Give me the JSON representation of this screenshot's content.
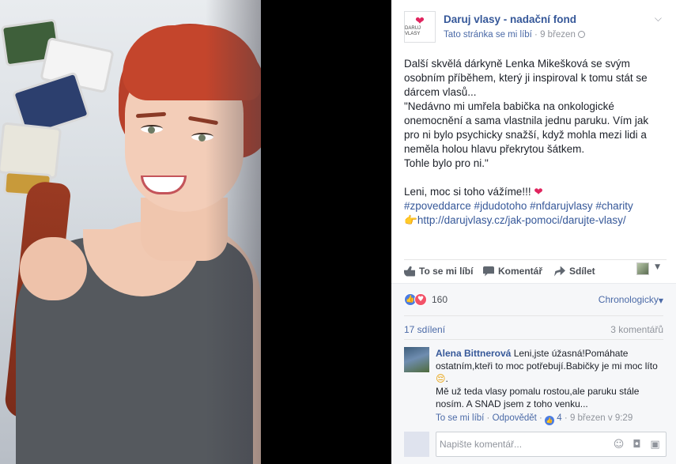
{
  "post": {
    "page_name": "Daruj vlasy - nadační fond",
    "logo_text": "DARUJ VLASY",
    "like_status": "Tato stránka se mi líbí",
    "separator": " · ",
    "date": "9 březen",
    "paragraphs": [
      "Další skvělá dárkyně Lenka Mikešková se svým osobním příběhem, který ji inspiroval k tomu stát se dárcem vlasů...",
      "\"Nedávno mi umřela babička na onkologické onemocnění a sama vlastnila jednu paruku. Vím jak pro ni bylo psychicky snažší, když mohla mezi lidi a neměla holou hlavu překrytou šátkem.",
      "Tohle bylo pro ni.\""
    ],
    "thanks": "Leni, moc si toho vážíme!!!",
    "heart_symbol": "❤",
    "hashtags": "#zpoveddarce #jdudotoho #nfdarujvlasy #charity",
    "point_symbol": "👉",
    "link": "http://darujvlasy.cz/jak-pomoci/darujte-vlasy/"
  },
  "actions": {
    "like": "To se mi líbí",
    "comment": "Komentář",
    "share": "Sdílet"
  },
  "feedback": {
    "reaction_count": "160",
    "sort_label": "Chronologicky",
    "shares": "17 sdílení",
    "comments": "3 komentářů"
  },
  "comment": {
    "author": "Alena Bittnerová",
    "text_1": "Leni,jste úžasná!Pomáhate ostatním,kteři to moc potřebují.Babičky je mi moc líto",
    "sad_symbol": "😔",
    "text_1_end": ".",
    "text_2": "Mě už teda vlasy pomalu rostou,ale paruku stále nosím. A SNAD jsem z toho venku...",
    "like_link": "To se mi líbí",
    "reply_link": "Odpovědět",
    "likes": "4",
    "timestamp": "9 březen v 9:29"
  },
  "composer": {
    "placeholder": "Napište komentář..."
  },
  "colors": {
    "facebook_blue": "#365899",
    "heart_red": "#e0245e",
    "panel_gray": "#f6f7f9"
  }
}
